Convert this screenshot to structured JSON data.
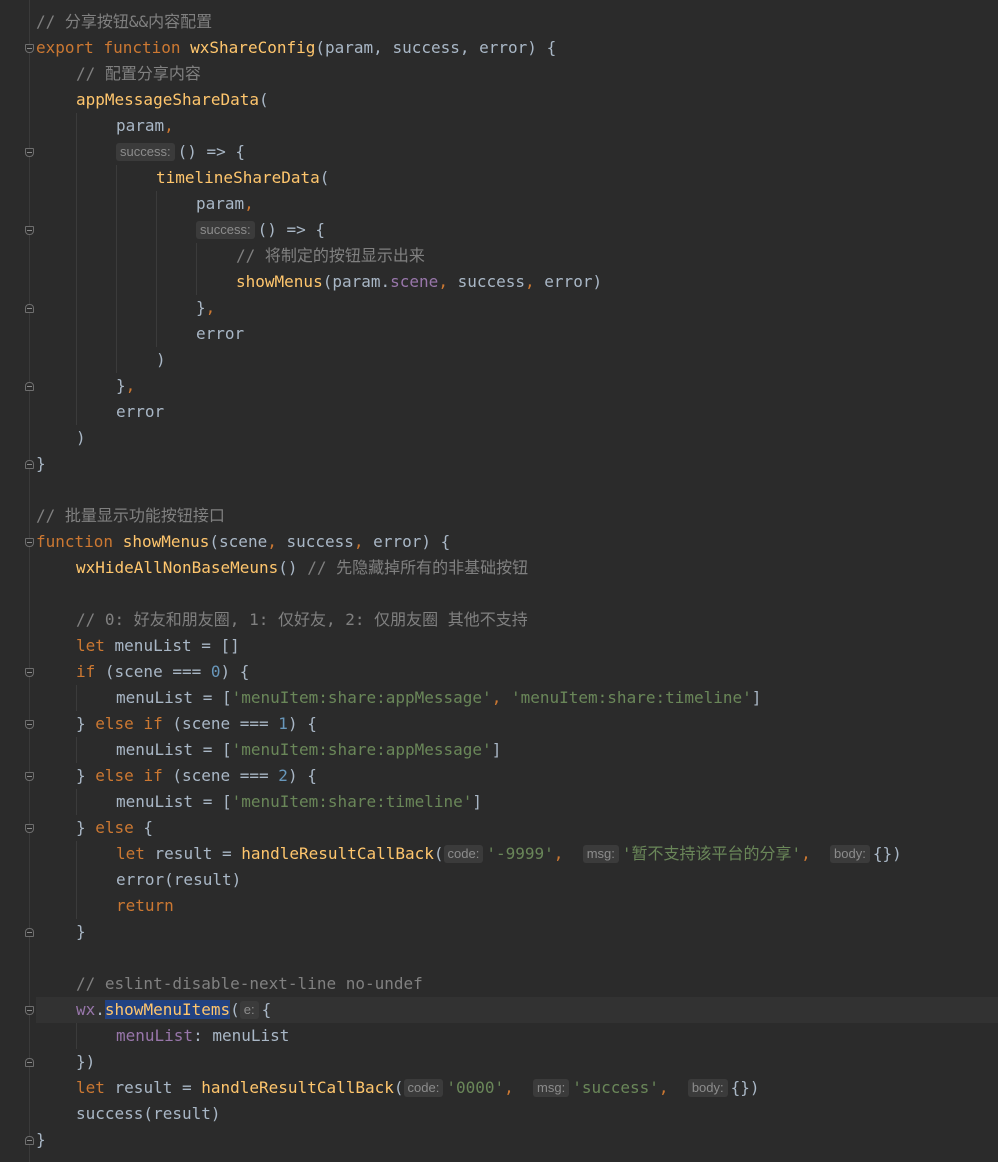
{
  "editor": {
    "theme_colors": {
      "background": "#2b2b2b",
      "keyword": "#cc7832",
      "function": "#ffc66d",
      "string": "#6a8759",
      "number": "#6897bb",
      "comment": "#808080",
      "property": "#9876aa",
      "text": "#a9b7c6",
      "selection": "#214283"
    },
    "lines": [
      {
        "indent": 0,
        "fold": null,
        "tokens": [
          [
            "cmt",
            "// 分享按钮&&内容配置"
          ]
        ]
      },
      {
        "indent": 0,
        "fold": "open",
        "tokens": [
          [
            "kw",
            "export"
          ],
          [
            "",
            " "
          ],
          [
            "kw",
            "function"
          ],
          [
            "",
            " "
          ],
          [
            "fn",
            "wxShareConfig"
          ],
          [
            "",
            "(param, success, error) {"
          ]
        ]
      },
      {
        "indent": 1,
        "fold": null,
        "tokens": [
          [
            "cmt",
            "// 配置分享内容"
          ]
        ]
      },
      {
        "indent": 1,
        "fold": null,
        "tokens": [
          [
            "fn",
            "appMessageShareData"
          ],
          [
            "",
            "("
          ]
        ]
      },
      {
        "indent": 2,
        "fold": null,
        "tokens": [
          [
            "",
            "param"
          ],
          [
            "kw",
            ","
          ]
        ]
      },
      {
        "indent": 2,
        "fold": "open",
        "tokens": [
          [
            "hint",
            "success:"
          ],
          [
            "",
            "() => {"
          ]
        ]
      },
      {
        "indent": 3,
        "fold": null,
        "tokens": [
          [
            "fn",
            "timelineShareData"
          ],
          [
            "",
            "("
          ]
        ]
      },
      {
        "indent": 4,
        "fold": null,
        "tokens": [
          [
            "",
            "param"
          ],
          [
            "kw",
            ","
          ]
        ]
      },
      {
        "indent": 4,
        "fold": "open",
        "tokens": [
          [
            "hint",
            "success:"
          ],
          [
            "",
            "() => {"
          ]
        ]
      },
      {
        "indent": 5,
        "fold": null,
        "tokens": [
          [
            "cmt",
            "// 将制定的按钮显示出来"
          ]
        ]
      },
      {
        "indent": 5,
        "fold": null,
        "tokens": [
          [
            "fn",
            "showMenus"
          ],
          [
            "",
            "(param."
          ],
          [
            "prop",
            "scene"
          ],
          [
            "kw",
            ","
          ],
          [
            "",
            " success"
          ],
          [
            "kw",
            ","
          ],
          [
            "",
            " error)"
          ]
        ]
      },
      {
        "indent": 4,
        "fold": "close",
        "tokens": [
          [
            "",
            "}"
          ],
          [
            "kw",
            ","
          ]
        ]
      },
      {
        "indent": 4,
        "fold": null,
        "tokens": [
          [
            "",
            "error"
          ]
        ]
      },
      {
        "indent": 3,
        "fold": null,
        "tokens": [
          [
            "",
            ")"
          ]
        ]
      },
      {
        "indent": 2,
        "fold": "close",
        "tokens": [
          [
            "",
            "}"
          ],
          [
            "kw",
            ","
          ]
        ]
      },
      {
        "indent": 2,
        "fold": null,
        "tokens": [
          [
            "",
            "error"
          ]
        ]
      },
      {
        "indent": 1,
        "fold": null,
        "tokens": [
          [
            "",
            ")"
          ]
        ]
      },
      {
        "indent": 0,
        "fold": "close",
        "tokens": [
          [
            "",
            "}"
          ]
        ]
      },
      {
        "indent": 0,
        "fold": null,
        "tokens": []
      },
      {
        "indent": 0,
        "fold": null,
        "tokens": [
          [
            "cmt",
            "// 批量显示功能按钮接口"
          ]
        ]
      },
      {
        "indent": 0,
        "fold": "open",
        "tokens": [
          [
            "kw",
            "function"
          ],
          [
            "",
            " "
          ],
          [
            "fn",
            "showMenus"
          ],
          [
            "",
            "(scene"
          ],
          [
            "kw",
            ","
          ],
          [
            "",
            " success"
          ],
          [
            "kw",
            ","
          ],
          [
            "",
            " error) {"
          ]
        ]
      },
      {
        "indent": 1,
        "fold": null,
        "tokens": [
          [
            "fn",
            "wxHideAllNonBaseMeuns"
          ],
          [
            "",
            "() "
          ],
          [
            "cmt",
            "// 先隐藏掉所有的非基础按钮"
          ]
        ]
      },
      {
        "indent": 0,
        "fold": null,
        "tokens": []
      },
      {
        "indent": 1,
        "fold": null,
        "tokens": [
          [
            "cmt",
            "// 0: 好友和朋友圈, 1: 仅好友, 2: 仅朋友圈 其他不支持"
          ]
        ]
      },
      {
        "indent": 1,
        "fold": null,
        "tokens": [
          [
            "kw",
            "let"
          ],
          [
            "",
            " menuList = []"
          ]
        ]
      },
      {
        "indent": 1,
        "fold": "open",
        "tokens": [
          [
            "kw",
            "if"
          ],
          [
            "",
            " (scene === "
          ],
          [
            "num",
            "0"
          ],
          [
            "",
            ") {"
          ]
        ]
      },
      {
        "indent": 2,
        "fold": null,
        "tokens": [
          [
            "",
            "menuList = ["
          ],
          [
            "str",
            "'menuItem:share:appMessage'"
          ],
          [
            "kw",
            ","
          ],
          [
            "",
            " "
          ],
          [
            "str",
            "'menuItem:share:timeline'"
          ],
          [
            "",
            "]"
          ]
        ]
      },
      {
        "indent": 1,
        "fold": "both",
        "tokens": [
          [
            "",
            "} "
          ],
          [
            "kw",
            "else"
          ],
          [
            "",
            " "
          ],
          [
            "kw",
            "if"
          ],
          [
            "",
            " (scene === "
          ],
          [
            "num",
            "1"
          ],
          [
            "",
            ") {"
          ]
        ]
      },
      {
        "indent": 2,
        "fold": null,
        "tokens": [
          [
            "",
            "menuList = ["
          ],
          [
            "str",
            "'menuItem:share:appMessage'"
          ],
          [
            "",
            "]"
          ]
        ]
      },
      {
        "indent": 1,
        "fold": "both",
        "tokens": [
          [
            "",
            "} "
          ],
          [
            "kw",
            "else"
          ],
          [
            "",
            " "
          ],
          [
            "kw",
            "if"
          ],
          [
            "",
            " (scene === "
          ],
          [
            "num",
            "2"
          ],
          [
            "",
            ") {"
          ]
        ]
      },
      {
        "indent": 2,
        "fold": null,
        "tokens": [
          [
            "",
            "menuList = ["
          ],
          [
            "str",
            "'menuItem:share:timeline'"
          ],
          [
            "",
            "]"
          ]
        ]
      },
      {
        "indent": 1,
        "fold": "both",
        "tokens": [
          [
            "",
            "} "
          ],
          [
            "kw",
            "else"
          ],
          [
            "",
            " {"
          ]
        ]
      },
      {
        "indent": 2,
        "fold": null,
        "tokens": [
          [
            "kw",
            "let"
          ],
          [
            "",
            " result = "
          ],
          [
            "fn",
            "handleResultCallBack"
          ],
          [
            "",
            "("
          ],
          [
            "hint",
            "code:"
          ],
          [
            "str",
            "'-9999'"
          ],
          [
            "kw",
            ","
          ],
          [
            "",
            "  "
          ],
          [
            "hint",
            "msg:"
          ],
          [
            "str",
            "'暂不支持该平台的分享'"
          ],
          [
            "kw",
            ","
          ],
          [
            "",
            "  "
          ],
          [
            "hint",
            "body:"
          ],
          [
            "",
            "{})"
          ]
        ]
      },
      {
        "indent": 2,
        "fold": null,
        "tokens": [
          [
            "",
            "error(result)"
          ]
        ]
      },
      {
        "indent": 2,
        "fold": null,
        "tokens": [
          [
            "kw",
            "return"
          ]
        ]
      },
      {
        "indent": 1,
        "fold": "close",
        "tokens": [
          [
            "",
            "}"
          ]
        ]
      },
      {
        "indent": 0,
        "fold": null,
        "tokens": []
      },
      {
        "indent": 1,
        "fold": null,
        "tokens": [
          [
            "cmt",
            "// eslint-disable-next-line no-undef"
          ]
        ]
      },
      {
        "indent": 1,
        "fold": "open",
        "hl": true,
        "tokens": [
          [
            "prop",
            "wx"
          ],
          [
            "",
            "."
          ],
          [
            "sel",
            "showMenuItems"
          ],
          [
            "",
            "("
          ],
          [
            "hint",
            "e:"
          ],
          [
            "",
            "{"
          ]
        ]
      },
      {
        "indent": 2,
        "fold": null,
        "tokens": [
          [
            "prop",
            "menuList"
          ],
          [
            "",
            ": menuList"
          ]
        ]
      },
      {
        "indent": 1,
        "fold": "close",
        "tokens": [
          [
            "",
            "})"
          ]
        ]
      },
      {
        "indent": 1,
        "fold": null,
        "tokens": [
          [
            "kw",
            "let"
          ],
          [
            "",
            " result = "
          ],
          [
            "fn",
            "handleResultCallBack"
          ],
          [
            "",
            "("
          ],
          [
            "hint",
            "code:"
          ],
          [
            "str",
            "'0000'"
          ],
          [
            "kw",
            ","
          ],
          [
            "",
            "  "
          ],
          [
            "hint",
            "msg:"
          ],
          [
            "str",
            "'success'"
          ],
          [
            "kw",
            ","
          ],
          [
            "",
            "  "
          ],
          [
            "hint",
            "body:"
          ],
          [
            "",
            "{})"
          ]
        ]
      },
      {
        "indent": 1,
        "fold": null,
        "tokens": [
          [
            "",
            "success(result)"
          ]
        ]
      },
      {
        "indent": 0,
        "fold": "close",
        "tokens": [
          [
            "",
            "}"
          ]
        ]
      }
    ]
  }
}
